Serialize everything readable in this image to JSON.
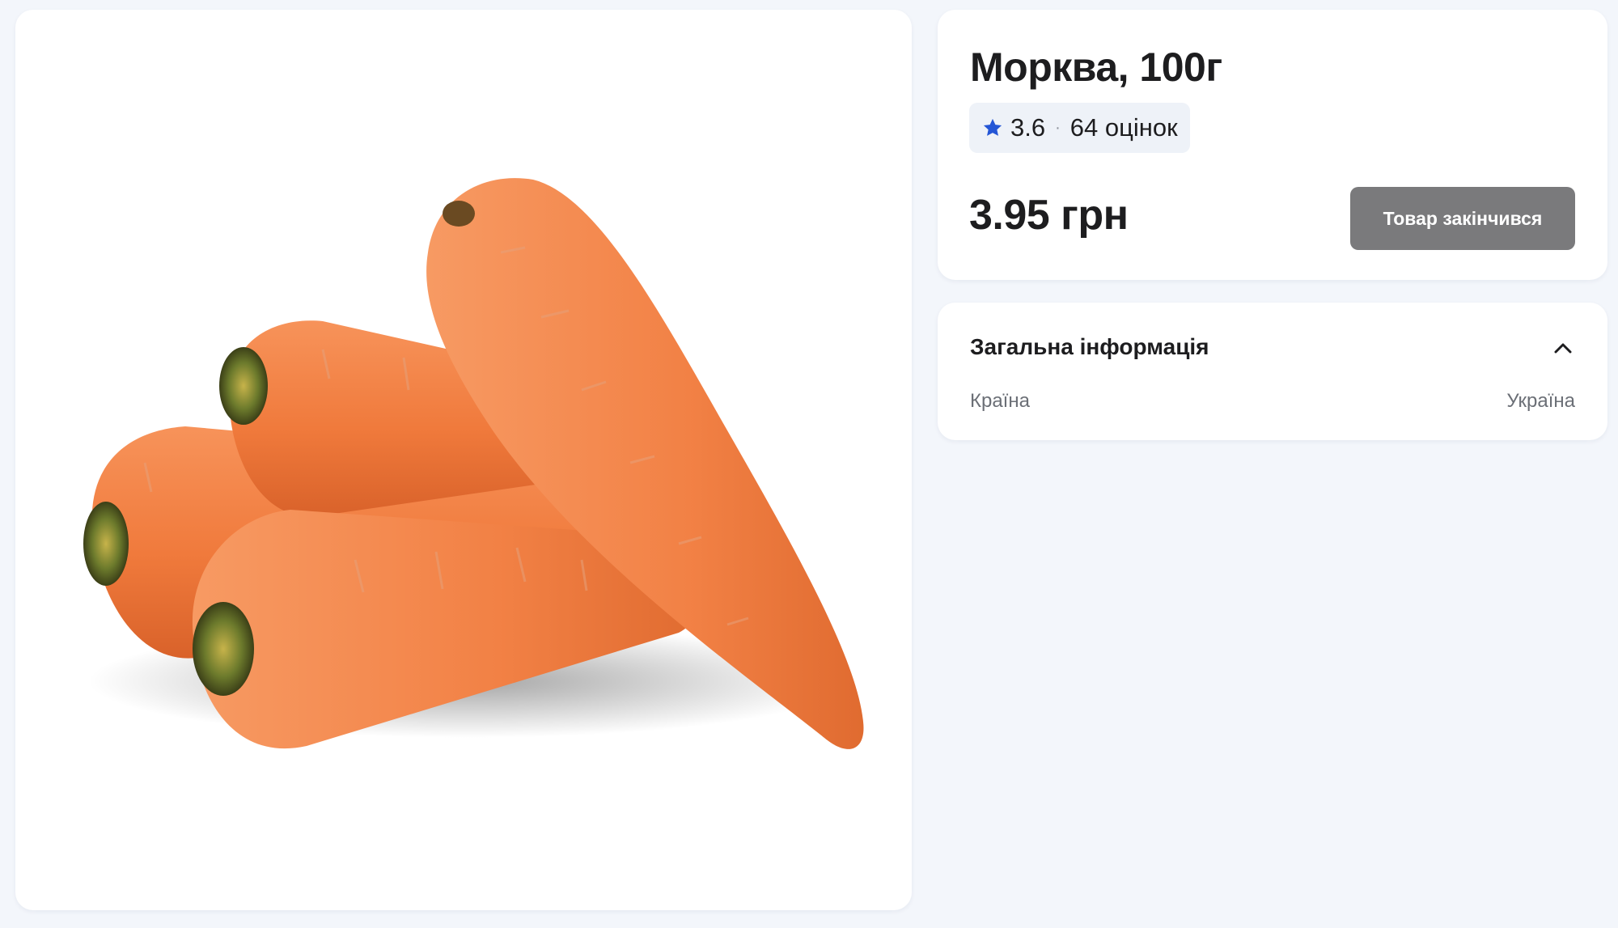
{
  "product": {
    "title": "Морква, 100г",
    "image_alt": "carrots",
    "rating": {
      "value": "3.6",
      "separator": "·",
      "count_label": "64 оцінок",
      "star_icon": "star-icon",
      "star_color": "#2456d6"
    },
    "price": "3.95 грн",
    "status_button_label": "Товар закінчився",
    "status_button_color": "#7a7a7c"
  },
  "general_info": {
    "title": "Загальна інформація",
    "toggle_icon": "chevron-up-icon",
    "rows": [
      {
        "label": "Країна",
        "value": "Україна"
      }
    ]
  }
}
